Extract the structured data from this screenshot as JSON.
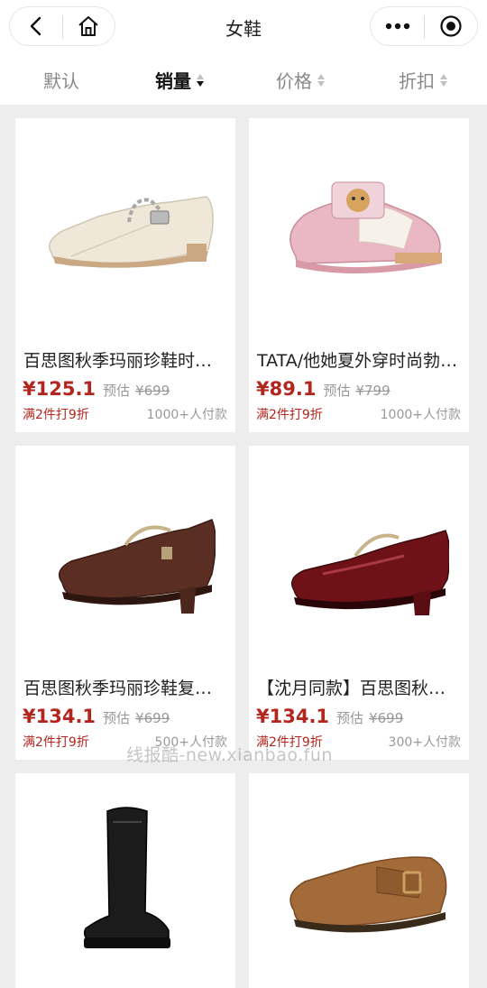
{
  "header": {
    "title": "女鞋"
  },
  "sort": {
    "items": [
      {
        "label": "默认"
      },
      {
        "label": "销量"
      },
      {
        "label": "价格"
      },
      {
        "label": "折扣"
      }
    ]
  },
  "products": [
    {
      "name": "百思图秋季玛丽珍鞋时…",
      "price": "¥125.1",
      "est_label": "预估",
      "orig": "¥699",
      "promo": "满2件打9折",
      "sold": "1000+人付款",
      "image": "cream-mary-jane-flat"
    },
    {
      "name": "TATA/他她夏外穿时尚勃…",
      "price": "¥89.1",
      "est_label": "预估",
      "orig": "¥799",
      "promo": "满2件打9折",
      "sold": "1000+人付款",
      "image": "pink-clog-mule"
    },
    {
      "name": "百思图秋季玛丽珍鞋复…",
      "price": "¥134.1",
      "est_label": "预估",
      "orig": "¥699",
      "promo": "满2件打9折",
      "sold": "500+人付款",
      "image": "brown-mary-jane-heel"
    },
    {
      "name": "【沈月同款】百思图秋…",
      "price": "¥134.1",
      "est_label": "预估",
      "orig": "¥699",
      "promo": "满2件打9折",
      "sold": "300+人付款",
      "image": "burgundy-patent-mary-jane"
    },
    {
      "name": "",
      "price": "",
      "est_label": "",
      "orig": "",
      "promo": "",
      "sold": "",
      "image": "black-knee-boot"
    },
    {
      "name": "",
      "price": "",
      "est_label": "",
      "orig": "",
      "promo": "",
      "sold": "",
      "image": "tan-suede-buckle-clog"
    }
  ],
  "watermark": "线报酷-new.xianbao.fun",
  "colors": {
    "price": "#b3261e",
    "background": "#ededed"
  }
}
